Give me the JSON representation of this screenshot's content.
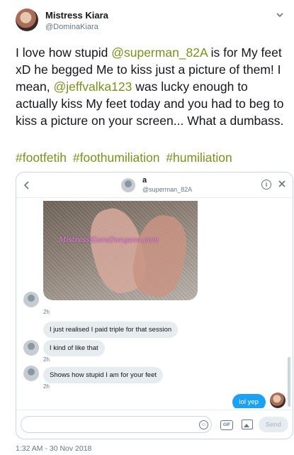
{
  "author": {
    "name": "Mistress Kiara",
    "handle": "@DominaKiara"
  },
  "tweet": {
    "text_parts": [
      {
        "type": "text",
        "value": "I love how stupid "
      },
      {
        "type": "mention",
        "value": "@superman_82A"
      },
      {
        "type": "text",
        "value": " is for My feet xD he begged Me to kiss just a picture of them! I mean, "
      },
      {
        "type": "mention",
        "value": "@jeffvalka123"
      },
      {
        "type": "text",
        "value": " was lucky enough to actually kiss My feet today and you had to beg to kiss a picture on your screen... What a dumbass."
      }
    ],
    "hashtags": [
      "#footfetih",
      "#foothumiliation",
      "#humiliation"
    ],
    "timestamp": "1:32 AM - 30 Nov 2018"
  },
  "dm": {
    "contact_name": "a",
    "contact_handle": "@superman_82A",
    "photo_watermark": "MistressKiaraDungeon.com",
    "messages": [
      {
        "from": "them",
        "kind": "photo",
        "time": "2h"
      },
      {
        "from": "them",
        "kind": "text",
        "text": "I just realised I paid triple for that session",
        "time": ""
      },
      {
        "from": "them",
        "kind": "text",
        "text": "I kind of like that",
        "time": "2h"
      },
      {
        "from": "them",
        "kind": "text",
        "text": "Shows how stupid I am for your feet",
        "time": "2h"
      },
      {
        "from": "me",
        "kind": "text",
        "text": "lol yep",
        "time": ""
      }
    ],
    "composer": {
      "placeholder": "",
      "gif_label": "GIF",
      "send_label": "Send"
    },
    "info_label": "i"
  },
  "colors": {
    "link": "#7a8f1e",
    "sent_bubble": "#1da1f2",
    "received_bubble": "#e6ecf0"
  }
}
